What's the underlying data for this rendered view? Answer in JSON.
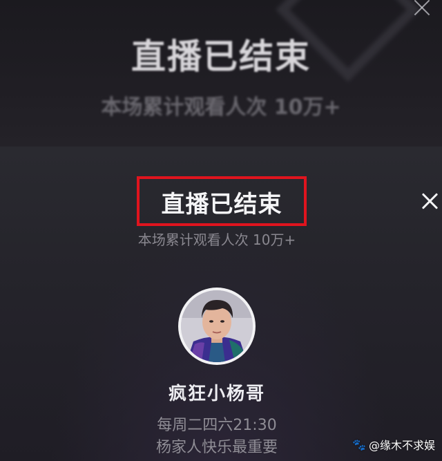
{
  "top": {
    "title": "直播已结束",
    "subtitle": "本场累计观看人次 10万+"
  },
  "main": {
    "title": "直播已结束",
    "subtitle": "本场累计观看人次 10万+",
    "highlight_color": "#e0141e"
  },
  "streamer": {
    "name": "疯狂小杨哥",
    "schedule": "每周二四六21:30",
    "motto": "杨家人快乐最重要"
  },
  "watermark": {
    "text": "@缘木不求娱",
    "icon": "paw-icon"
  },
  "icons": {
    "top_close": "close-icon",
    "main_close": "close-icon"
  }
}
